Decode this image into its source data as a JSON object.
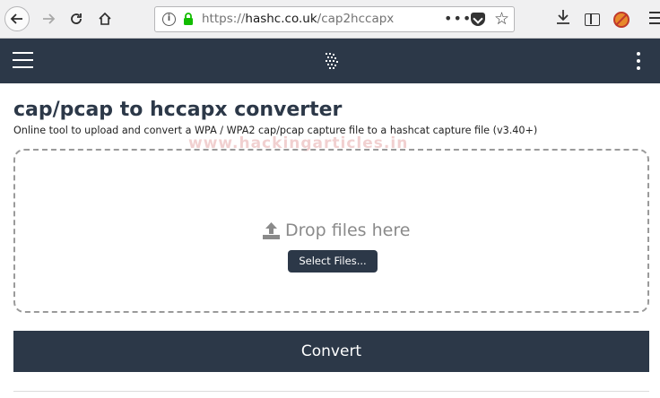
{
  "browser": {
    "url_prefix": "https://",
    "url_host": "hashc.co.uk",
    "url_path": "/cap2hccapx",
    "url_more": "•••"
  },
  "page": {
    "title": "cap/pcap to hccapx converter",
    "subtitle": "Online tool to upload and convert a WPA / WPA2 cap/pcap capture file to a hashcat capture file (v3.40+)",
    "watermark": "www.hackingarticles.in"
  },
  "dropzone": {
    "label": "Drop files here",
    "select_button": "Select Files..."
  },
  "actions": {
    "convert_label": "Convert"
  },
  "colors": {
    "header_bg": "#2c3848",
    "button_bg": "#2c3848"
  }
}
